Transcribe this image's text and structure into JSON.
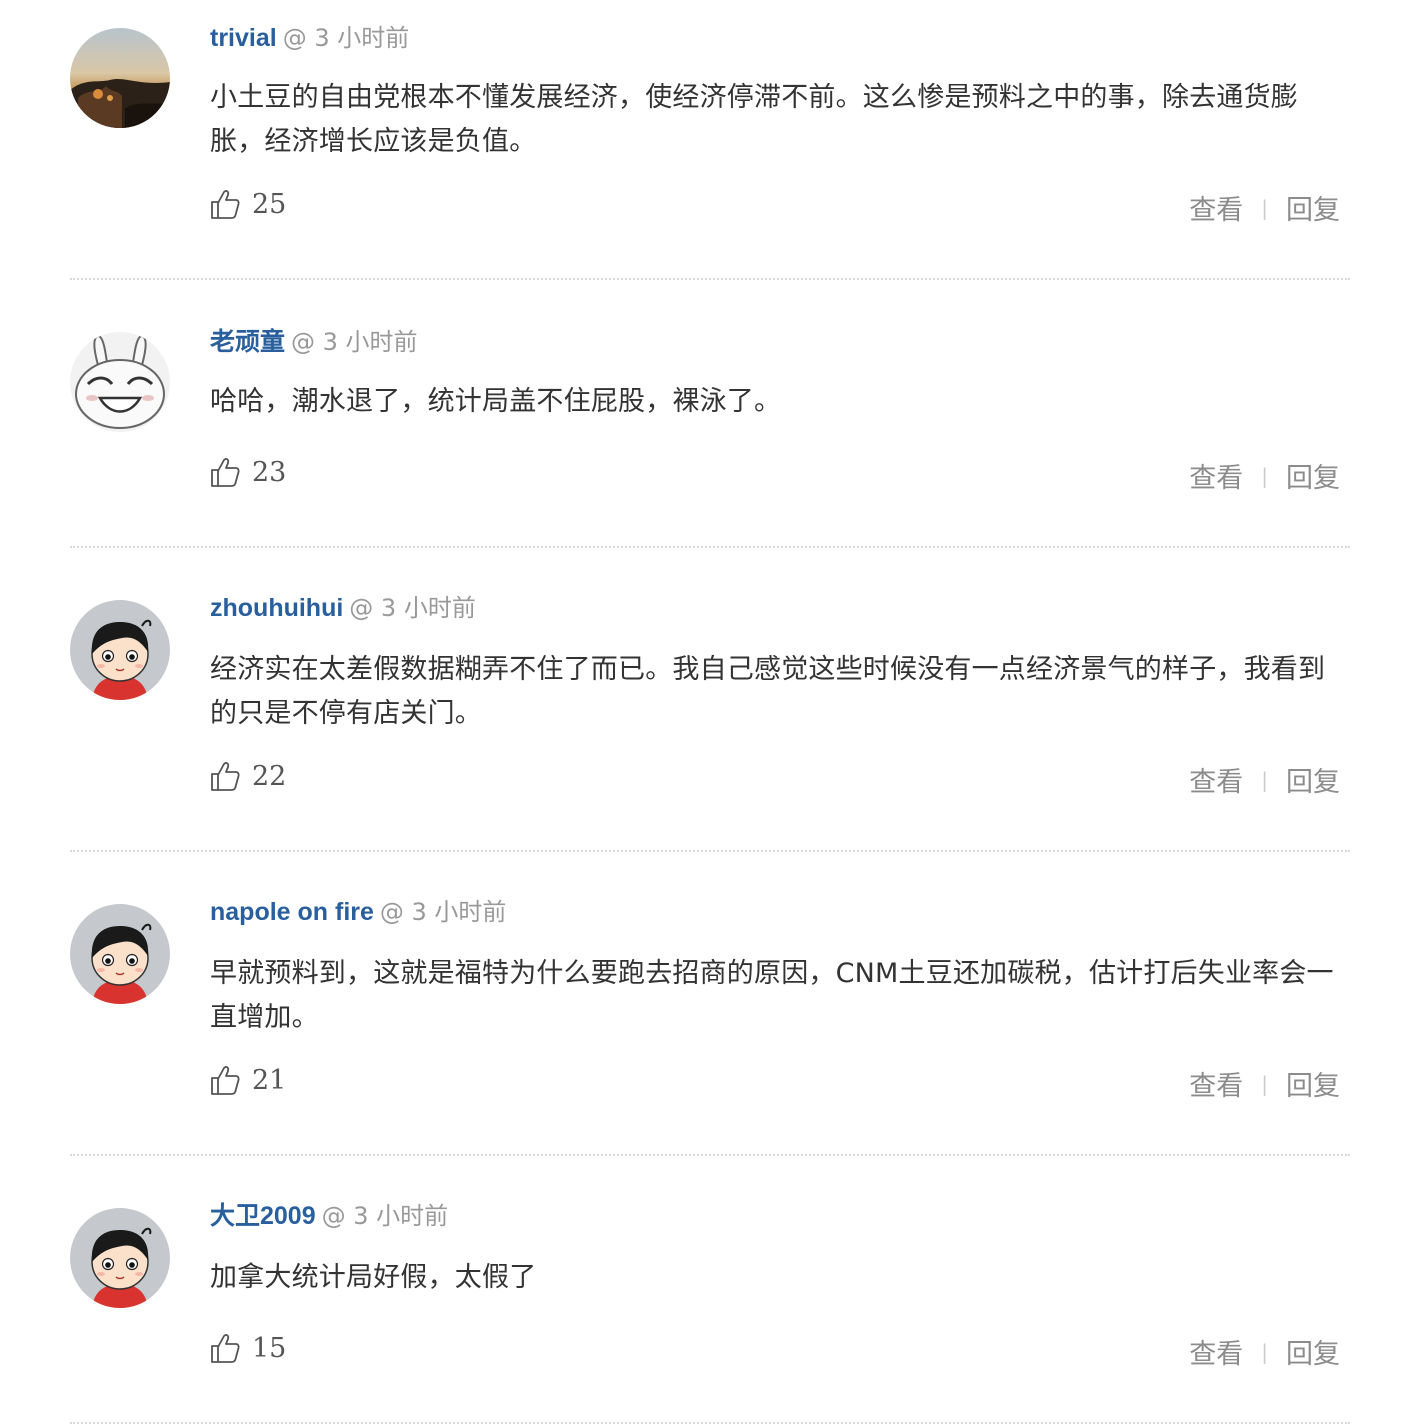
{
  "comments": [
    {
      "username": "trivial",
      "time": "@ 3 小时前",
      "text": "小土豆的自由党根本不懂发展经济，使经济停滞不前。这么惨是预料之中的事，除去通货膨胀，经济增长应该是负值。",
      "likes": "25",
      "view_label": "查看",
      "separator": "|",
      "reply_label": "回复",
      "avatar": "landscape-photo"
    },
    {
      "username": "老顽童",
      "time": "@ 3 小时前",
      "text": "哈哈，潮水退了，统计局盖不住屁股，裸泳了。",
      "likes": "23",
      "view_label": "查看",
      "separator": "|",
      "reply_label": "回复",
      "avatar": "grinning-bunny"
    },
    {
      "username": "zhouhuihui",
      "time": "@ 3 小时前",
      "text": "经济实在太差假数据糊弄不住了而已。我自己感觉这些时候没有一点经济景气的样子，我看到的只是不停有店关门。",
      "likes": "22",
      "view_label": "查看",
      "separator": "|",
      "reply_label": "回复",
      "avatar": "default-cartoon-boy"
    },
    {
      "username": "napole on fire",
      "time": "@ 3 小时前",
      "text": "早就预料到，这就是福特为什么要跑去招商的原因，CNM土豆还加碳税，估计打后失业率会一直增加。",
      "likes": "21",
      "view_label": "查看",
      "separator": "|",
      "reply_label": "回复",
      "avatar": "default-cartoon-boy"
    },
    {
      "username": "大卫2009",
      "time": "@ 3 小时前",
      "text": "加拿大统计局好假，太假了",
      "likes": "15",
      "view_label": "查看",
      "separator": "|",
      "reply_label": "回复",
      "avatar": "default-cartoon-boy"
    }
  ],
  "colors": {
    "username": "#2a5f9e",
    "meta": "#999999",
    "text": "#333333",
    "link": "#8c8c8c",
    "divider": "#d9d9d9"
  },
  "icons": {
    "like": "thumbs-up-outline-icon"
  }
}
